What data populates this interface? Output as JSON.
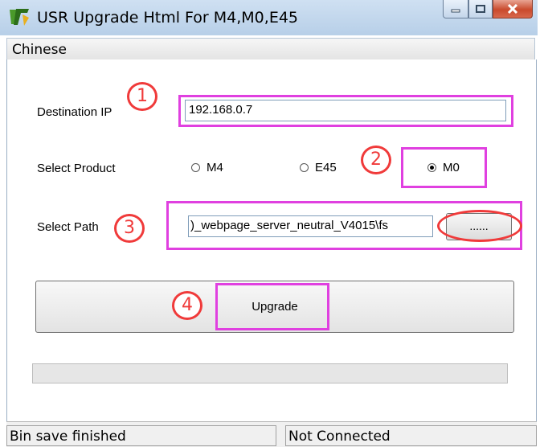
{
  "window": {
    "title": "USR Upgrade Html For M4,M0,E45",
    "controls": [
      "minimize-icon",
      "maximize-icon",
      "close-icon"
    ]
  },
  "menu": {
    "items": [
      "Chinese"
    ]
  },
  "form": {
    "destination_ip": {
      "label": "Destination IP",
      "value": "192.168.0.7"
    },
    "product": {
      "label": "Select Product",
      "options": [
        "M4",
        "E45",
        "M0"
      ],
      "selected": "M0"
    },
    "path": {
      "label": "Select Path",
      "value": ")_webpage_server_neutral_V4015\\fs",
      "browse_label": "......"
    },
    "upgrade_label": "Upgrade",
    "progress": 0
  },
  "status": {
    "left": "Bin save finished",
    "right": "Not Connected"
  },
  "annotations": {
    "markers": [
      "1",
      "2",
      "3",
      "4"
    ],
    "color": "#f03a3a",
    "highlight": "#e040e0"
  }
}
